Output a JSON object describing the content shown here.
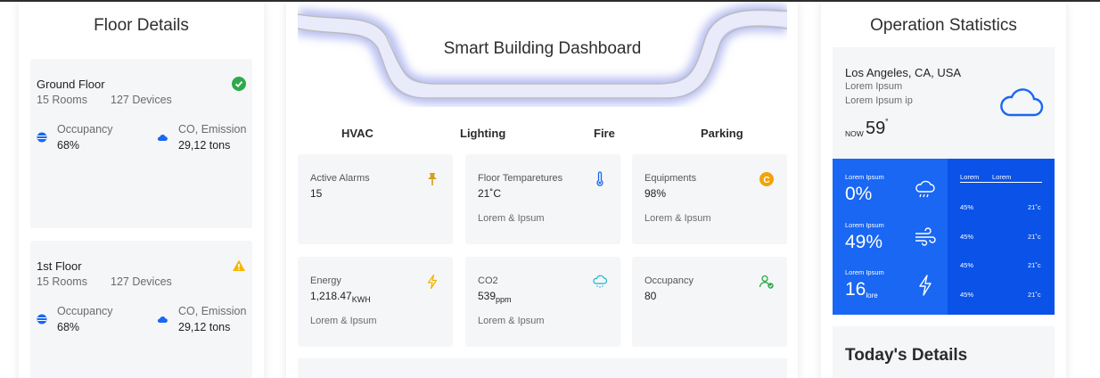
{
  "floor_panel": {
    "title": "Floor Details",
    "floors": [
      {
        "name": "Ground Floor",
        "rooms": "15 Rooms",
        "devices": "127 Devices",
        "status_icon": "check-circle-icon",
        "occupancy_label": "Occupancy",
        "occupancy_value": "68%",
        "emission_label": "CO, Emission",
        "emission_value": "29,12 tons"
      },
      {
        "name": "1st Floor",
        "rooms": "15 Rooms",
        "devices": "127 Devices",
        "status_icon": "warning-triangle-icon",
        "occupancy_label": "Occupancy",
        "occupancy_value": "68%",
        "emission_label": "CO, Emission",
        "emission_value": "29,12 tons"
      }
    ]
  },
  "dashboard": {
    "title": "Smart Building Dashboard",
    "tabs": [
      "HVAC",
      "Lighting",
      "Fire",
      "Parking"
    ],
    "tiles": [
      {
        "label": "Active Alarms",
        "value": "15",
        "unit": "",
        "sub": "",
        "icon": "pin-icon"
      },
      {
        "label": "Floor Temparetures",
        "value": "21˚C",
        "unit": "",
        "sub": "Lorem & Ipsum",
        "icon": "thermometer-icon"
      },
      {
        "label": "Equipments",
        "value": "98%",
        "unit": "",
        "sub": "Lorem & Ipsum",
        "icon": "c-badge-icon"
      },
      {
        "label": "Energy",
        "value": "1,218.47",
        "unit": "KWH",
        "sub": "Lorem & Ipsum",
        "icon": "lightning-icon"
      },
      {
        "label": "CO2",
        "value": "539",
        "unit": "ppm",
        "sub": "Lorem & Ipsum",
        "icon": "cloud-snow-icon"
      },
      {
        "label": "Occupancy",
        "value": "80",
        "unit": "",
        "sub": "",
        "icon": "user-check-icon"
      }
    ]
  },
  "stats_panel": {
    "title": "Operation Statistics",
    "weather": {
      "city": "Los Angeles, CA, USA",
      "line1": "Lorem Ipsum",
      "line2": "Lorem Ipsum ip",
      "now_label": "NOW",
      "temp": "59",
      "degree": "˚"
    },
    "metrics": [
      {
        "label": "Lorem Ipsum",
        "value": "0%",
        "unit": "",
        "icon": "cloud-rain-icon"
      },
      {
        "label": "Lorem Ipsum",
        "value": "49%",
        "unit": "",
        "icon": "wind-icon"
      },
      {
        "label": "Lorem Ipsum",
        "value": "16",
        "unit": "lore",
        "icon": "lightning-icon"
      }
    ],
    "table": {
      "headers": [
        "Lorem",
        "Lorem"
      ],
      "rows": [
        {
          "a": "45%",
          "b": "21˚c"
        },
        {
          "a": "45%",
          "b": "21˚c"
        },
        {
          "a": "45%",
          "b": "21˚c"
        },
        {
          "a": "45%",
          "b": "21˚c"
        }
      ]
    },
    "today_title": "Today's Details"
  },
  "colors": {
    "accent_blue": "#1967f2",
    "accent_blue_dark": "#0a52e8",
    "success_green": "#2eaa4a",
    "warning_yellow": "#f5b800",
    "card_bg": "#f5f6f8"
  }
}
